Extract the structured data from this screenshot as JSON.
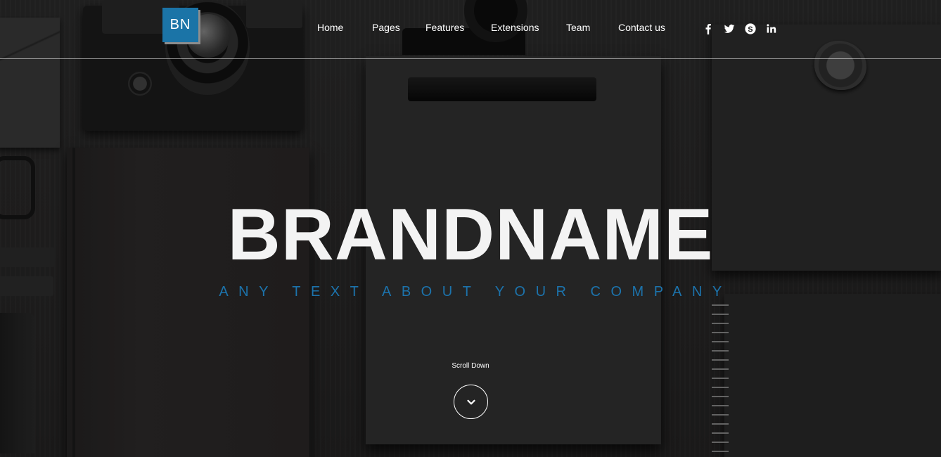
{
  "brand": {
    "logo_text": "BN",
    "logo_color": "#1b74a7"
  },
  "nav": {
    "items": [
      {
        "label": "Home"
      },
      {
        "label": "Pages"
      },
      {
        "label": "Features"
      },
      {
        "label": "Extensions"
      },
      {
        "label": "Team"
      },
      {
        "label": "Contact us"
      }
    ]
  },
  "social": {
    "icons": [
      "facebook-icon",
      "twitter-icon",
      "skype-icon",
      "linkedin-icon"
    ]
  },
  "hero": {
    "title": "BRANDNAME",
    "subtitle": "ANY TEXT ABOUT YOUR COMPANY",
    "subtitle_color": "#1c73ac",
    "scroll_label": "Scroll Down",
    "scroll_icon": "chevron-down-icon"
  }
}
